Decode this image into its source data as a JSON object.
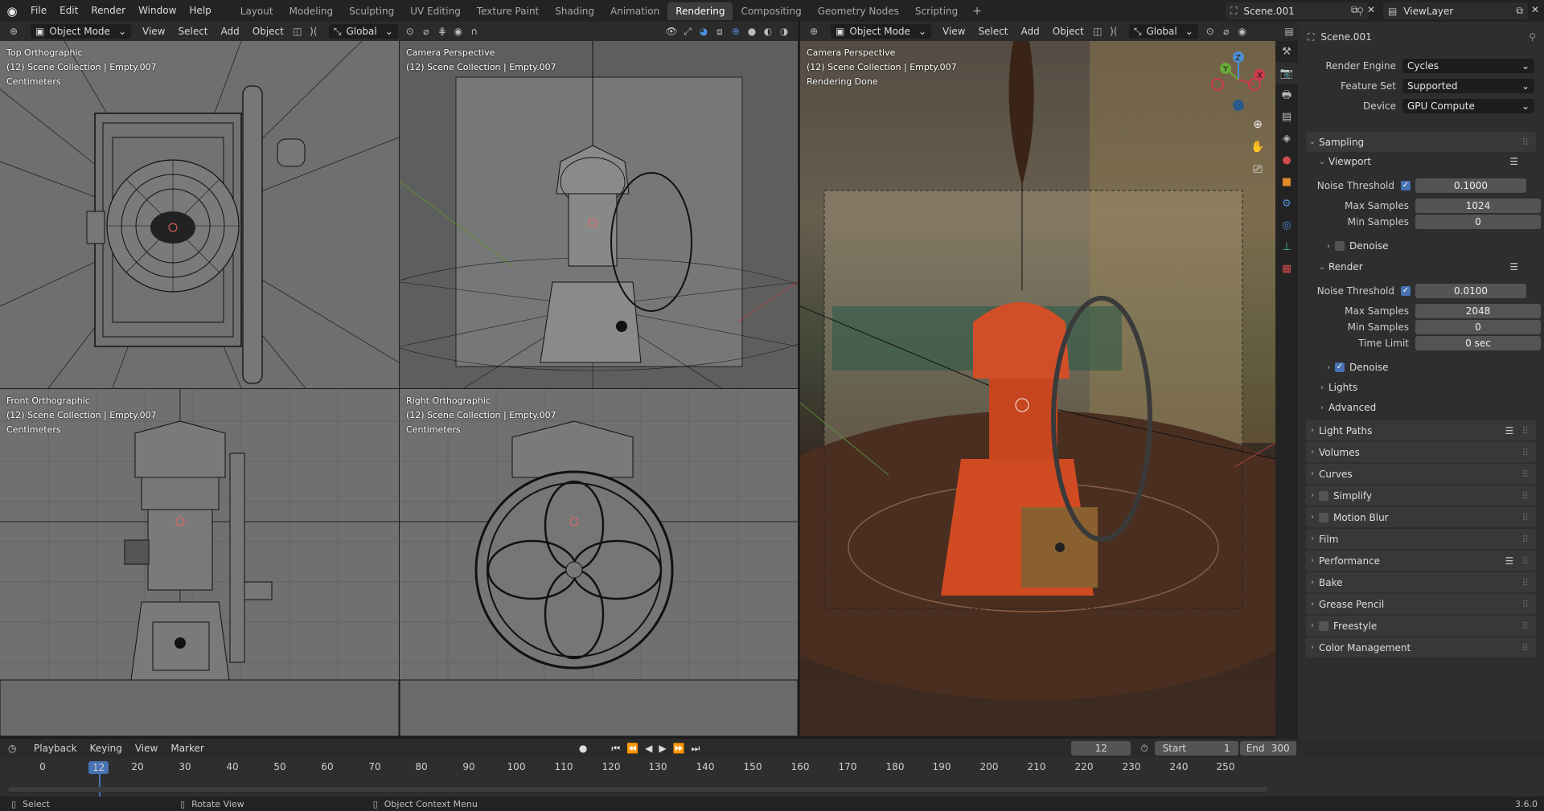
{
  "menu": [
    "File",
    "Edit",
    "Render",
    "Window",
    "Help"
  ],
  "workspaces": [
    "Layout",
    "Modeling",
    "Sculpting",
    "UV Editing",
    "Texture Paint",
    "Shading",
    "Animation",
    "Rendering",
    "Compositing",
    "Geometry Nodes",
    "Scripting"
  ],
  "active_workspace": "Rendering",
  "scene": "Scene.001",
  "view_layer": "ViewLayer",
  "left_header": {
    "mode": "Object Mode",
    "menus": [
      "View",
      "Select",
      "Add",
      "Object"
    ],
    "orientation": "Global"
  },
  "right_header": {
    "mode": "Object Mode",
    "menus": [
      "View",
      "Select",
      "Add",
      "Object"
    ],
    "orientation": "Global"
  },
  "viewports": [
    {
      "title": "Top Orthographic",
      "collection": "(12) Scene Collection | Empty.007",
      "extra": "Centimeters"
    },
    {
      "title": "Camera Perspective",
      "collection": "(12) Scene Collection | Empty.007",
      "extra": ""
    },
    {
      "title": "Front Orthographic",
      "collection": "(12) Scene Collection | Empty.007",
      "extra": "Centimeters"
    },
    {
      "title": "Right Orthographic",
      "collection": "(12) Scene Collection | Empty.007",
      "extra": "Centimeters"
    },
    {
      "title": "Camera Perspective",
      "collection": "(12) Scene Collection | Empty.007",
      "extra": "Rendering Done"
    }
  ],
  "gizmo": {
    "x": "X",
    "y": "Y",
    "z": "Z"
  },
  "properties": {
    "scene": "Scene.001",
    "render_engine_label": "Render Engine",
    "render_engine": "Cycles",
    "feature_set_label": "Feature Set",
    "feature_set": "Supported",
    "device_label": "Device",
    "device": "GPU Compute",
    "sampling": "Sampling",
    "viewport": "Viewport",
    "noise_threshold_label": "Noise Threshold",
    "vp_noise": "0.1000",
    "max_samples_label": "Max Samples",
    "vp_max": "1024",
    "min_samples_label": "Min Samples",
    "vp_min": "0",
    "denoise": "Denoise",
    "render": "Render",
    "r_noise": "0.0100",
    "r_max": "2048",
    "r_min": "0",
    "time_limit_label": "Time Limit",
    "r_time": "0 sec",
    "lights": "Lights",
    "advanced": "Advanced",
    "sections": [
      "Light Paths",
      "Volumes",
      "Curves",
      "Simplify",
      "Motion Blur",
      "Film",
      "Performance",
      "Bake",
      "Grease Pencil",
      "Freestyle",
      "Color Management"
    ]
  },
  "timeline": {
    "menus": [
      "Playback",
      "Keying",
      "View",
      "Marker"
    ],
    "current": "12",
    "start_label": "Start",
    "start": "1",
    "end_label": "End",
    "end": "300",
    "ticks": [
      "0",
      "12",
      "20",
      "30",
      "40",
      "50",
      "60",
      "70",
      "80",
      "90",
      "100",
      "110",
      "120",
      "130",
      "140",
      "150",
      "160",
      "170",
      "180",
      "190",
      "200",
      "210",
      "220",
      "230",
      "240",
      "250"
    ]
  },
  "status": {
    "select": "Select",
    "rotate": "Rotate View",
    "context": "Object Context Menu",
    "version": "3.6.0"
  }
}
